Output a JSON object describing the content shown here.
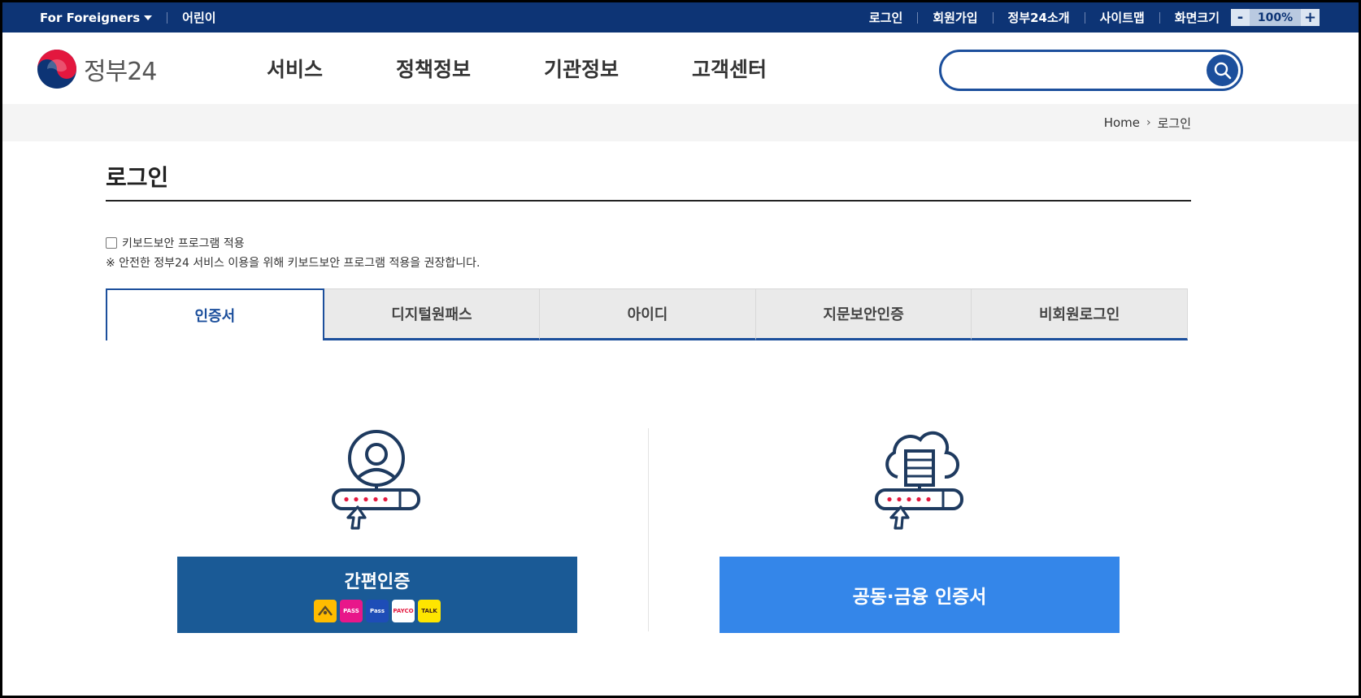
{
  "topbar": {
    "foreigners": "For Foreigners",
    "kids": "어린이",
    "links": [
      "로그인",
      "회원가입",
      "정부24소개",
      "사이트맵"
    ],
    "zoom_label": "화면크기",
    "zoom_minus": "-",
    "zoom_value": "100%",
    "zoom_plus": "+"
  },
  "header": {
    "logo_text": "정부24",
    "menu": [
      "서비스",
      "정책정보",
      "기관정보",
      "고객센터"
    ],
    "search_placeholder": ""
  },
  "breadcrumb": {
    "home": "Home",
    "current": "로그인"
  },
  "page": {
    "title": "로그인",
    "keyboard_security_label": "키보드보안 프로그램 적용",
    "keyboard_security_checked": false,
    "keyboard_security_note": "※ 안전한 정부24 서비스 이용을 위해 키보드보안 프로그램 적용을 권장합니다."
  },
  "tabs": [
    {
      "label": "인증서",
      "active": true
    },
    {
      "label": "디지털원패스",
      "active": false
    },
    {
      "label": "아이디",
      "active": false
    },
    {
      "label": "지문보안인증",
      "active": false
    },
    {
      "label": "비회원로그인",
      "active": false
    }
  ],
  "login_options": {
    "simple_auth": {
      "label": "간편인증",
      "providers": [
        "kb-icon",
        "pass-icon",
        "samsung-pass-icon",
        "payco-icon",
        "kakaotalk-icon"
      ],
      "provider_text": [
        "PASS",
        "Pass",
        "PAYCO",
        "TALK"
      ]
    },
    "cert": {
      "label": "공동·금융 인증서"
    }
  },
  "colors": {
    "topbar": "#0d3475",
    "primary": "#1c4f9c",
    "simple_button": "#1a5a96",
    "cert_button": "#3486e9",
    "icon_navy": "#1e3a5f",
    "dot_red": "#e3173e"
  }
}
